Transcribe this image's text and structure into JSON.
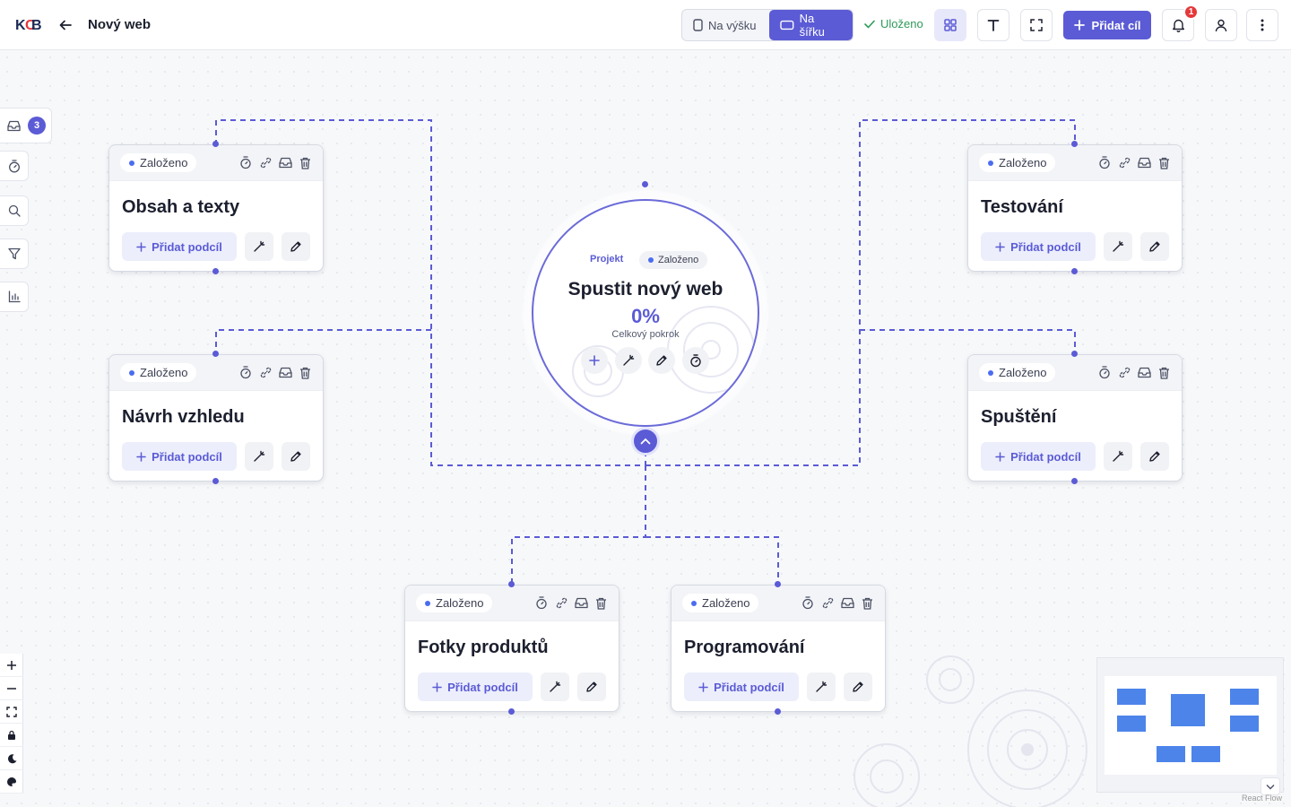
{
  "header": {
    "logo_text": "KCB",
    "project_title": "Nový web",
    "view_portrait": "Na výšku",
    "view_landscape": "Na šířku",
    "saved_status": "Uloženo",
    "add_goal_label": "Přidat cíl",
    "notification_count": "1"
  },
  "sidebar": {
    "inbox_count": "3",
    "tools": [
      "inbox-icon",
      "timer-icon",
      "search-icon",
      "filter-icon",
      "chart-icon"
    ]
  },
  "root": {
    "type_label": "Projekt",
    "status": "Založeno",
    "title": "Spustit nový web",
    "progress": "0%",
    "progress_value": 0,
    "progress_label": "Celkový pokrok"
  },
  "goals": [
    {
      "title": "Obsah a texty",
      "status": "Založeno",
      "add_label": "Přidat podcíl"
    },
    {
      "title": "Návrh vzhledu",
      "status": "Založeno",
      "add_label": "Přidat podcíl"
    },
    {
      "title": "Testování",
      "status": "Založeno",
      "add_label": "Přidat podcíl"
    },
    {
      "title": "Spuštění",
      "status": "Založeno",
      "add_label": "Přidat podcíl"
    },
    {
      "title": "Fotky produktů",
      "status": "Založeno",
      "add_label": "Přidat podcíl"
    },
    {
      "title": "Programování",
      "status": "Založeno",
      "add_label": "Přidat podcíl"
    }
  ],
  "canvas_controls": [
    "zoom-in-icon",
    "zoom-out-icon",
    "fit-view-icon",
    "lock-icon",
    "theme-icon",
    "palette-icon"
  ],
  "attribution": "React Flow",
  "colors": {
    "accent": "#5b5bd6",
    "status_dot": "#4a6cf0",
    "saved": "#2f9a5a",
    "notification": "#e5383b"
  }
}
